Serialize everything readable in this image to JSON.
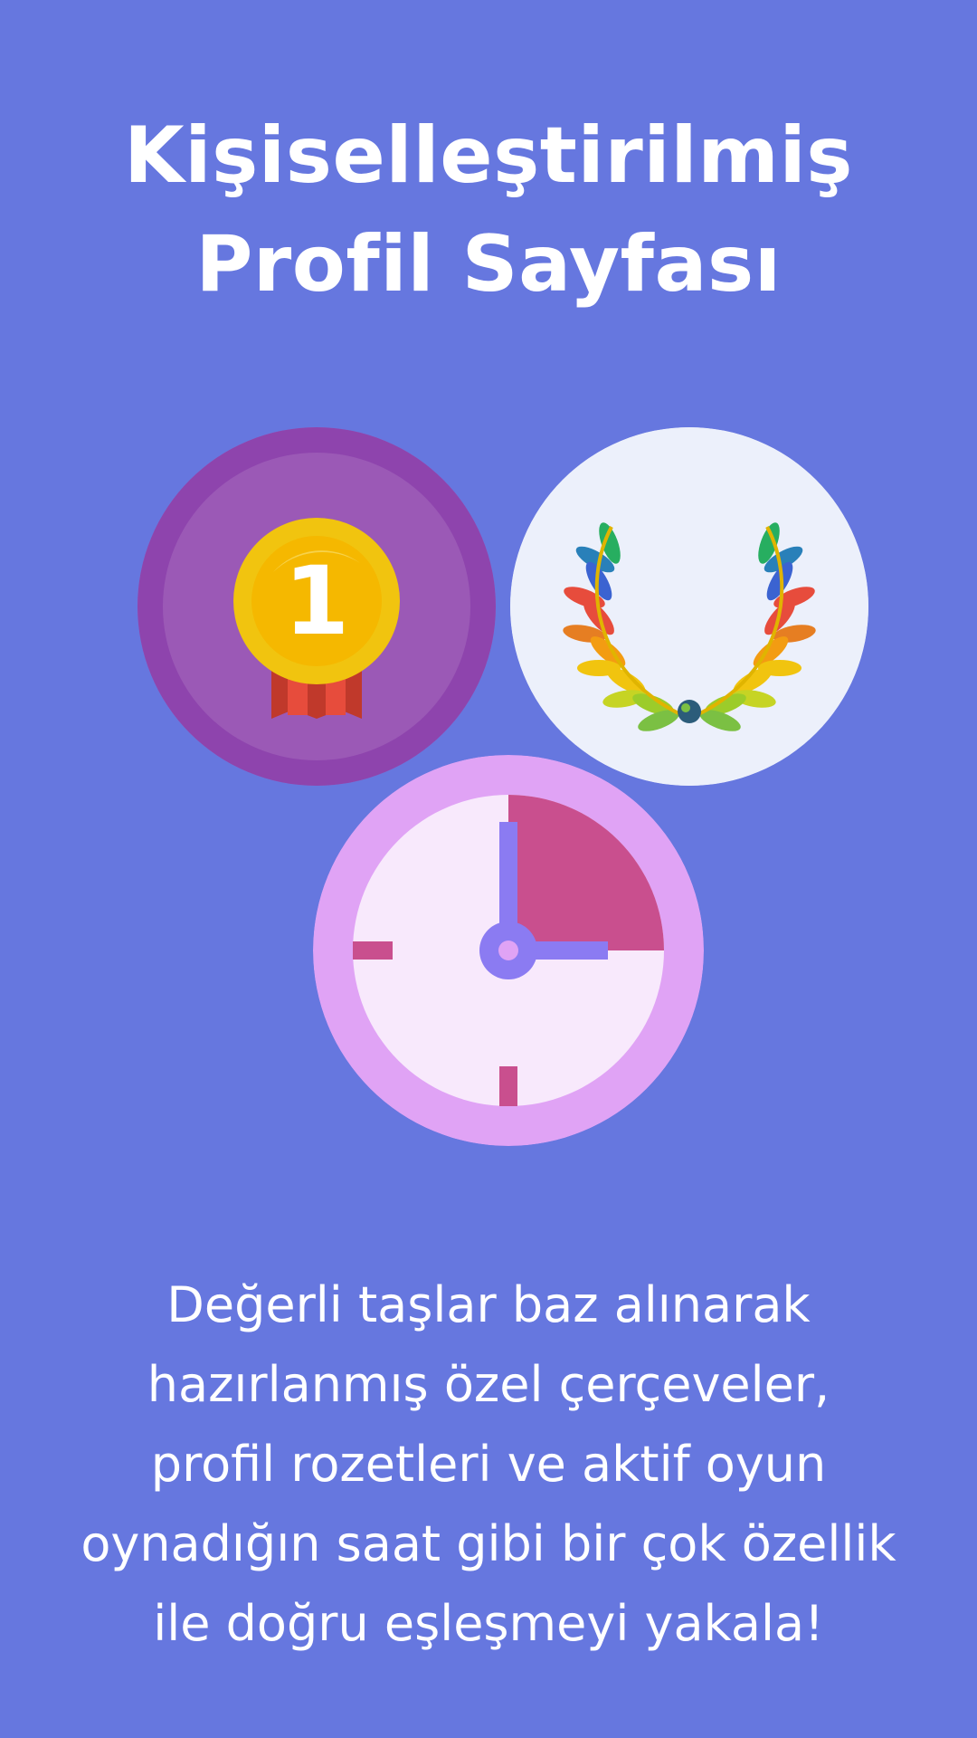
{
  "title": {
    "line1": "Kişiselleştirilmiş",
    "line2": "Profil Sayfası"
  },
  "icons": {
    "badge": {
      "name": "medal-icon",
      "number": "1"
    },
    "frame": {
      "name": "laurel-wreath-icon"
    },
    "clock": {
      "name": "clock-icon"
    }
  },
  "description": {
    "lines": [
      "Değerli taşlar baz alınarak",
      "hazırlanmış özel çerçeveler,",
      "profil rozetleri ve aktif oyun",
      "oynadığın saat gibi bir çok özellik",
      "ile doğru eşleşmeyi yakala!"
    ]
  },
  "colors": {
    "background": "#6677df",
    "badge_outer": "#8e44ad",
    "badge_inner": "#9b59b6",
    "medal_gold": "#f1c40f",
    "ribbon_red": "#e74c3c",
    "frame_bg": "#ecf0fb",
    "clock_outer": "#e0a3f5",
    "clock_face": "#f8e9fc",
    "clock_accent": "#c94f8e",
    "clock_hand": "#8b7bf2"
  }
}
